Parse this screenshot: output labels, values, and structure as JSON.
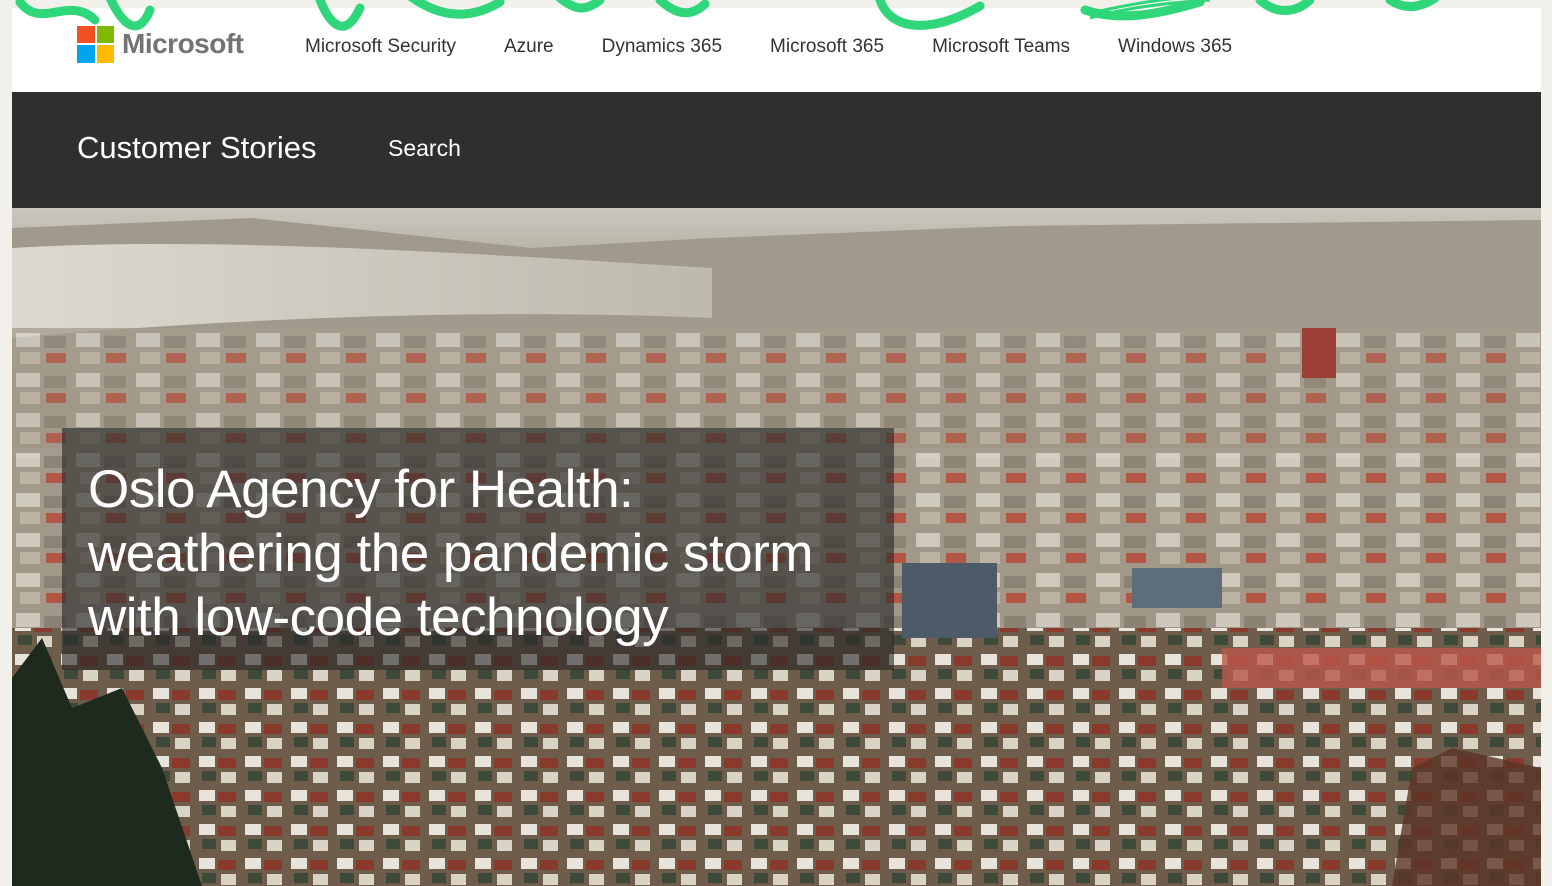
{
  "brand": {
    "name": "Microsoft",
    "logo_colors": [
      "#f25022",
      "#7fba00",
      "#00a4ef",
      "#ffb900"
    ]
  },
  "topnav": {
    "links": [
      {
        "label": "Microsoft Security"
      },
      {
        "label": "Azure"
      },
      {
        "label": "Dynamics 365"
      },
      {
        "label": "Microsoft 365"
      },
      {
        "label": "Microsoft Teams"
      },
      {
        "label": "Windows 365"
      }
    ]
  },
  "subnav": {
    "title": "Customer Stories",
    "search_label": "Search"
  },
  "hero": {
    "headline": "Oslo Agency for Health: weathering the pandemic storm with low-code technology"
  },
  "colors": {
    "accent_brush": "#2fd67a",
    "subnav_bg": "#2f2f2f"
  }
}
